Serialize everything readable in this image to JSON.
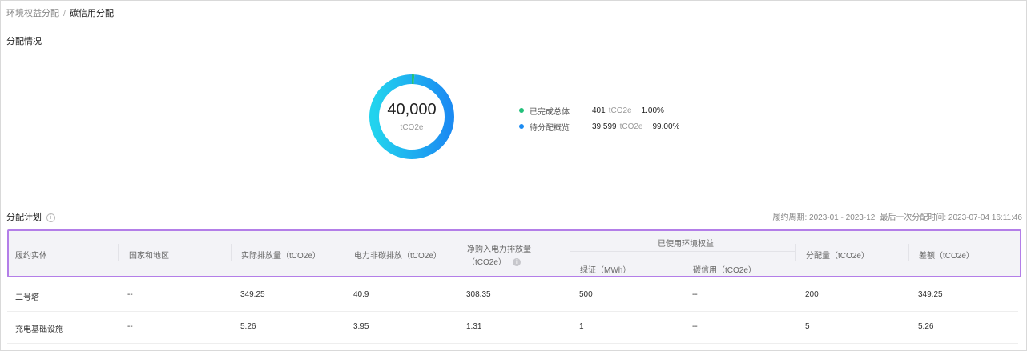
{
  "breadcrumb": {
    "parent": "环境权益分配",
    "separator": "/",
    "current": "碳信用分配"
  },
  "distribution": {
    "title": "分配情况",
    "total_value": "40,000",
    "total_unit": "tCO2e",
    "legend": [
      {
        "label": "已完成总体",
        "value": "401",
        "unit": "tCO2e",
        "percent": "1.00%",
        "color": "#22c07a",
        "fraction": 0.01
      },
      {
        "label": "待分配概览",
        "value": "39,599",
        "unit": "tCO2e",
        "percent": "99.00%",
        "color": "#1b8bf2",
        "fraction": 0.99
      }
    ]
  },
  "plan": {
    "title": "分配计划",
    "period_label": "履约周期: 2023-01 - 2023-12",
    "last_alloc_label": "最后一次分配时间: 2023-07-04 16:11:46"
  },
  "table": {
    "headers": {
      "entity": "履约实体",
      "region": "国家和地区",
      "actual": "实际排放量（tCO2e）",
      "power_noncarbon": "电力非碳排放（tCO2e）",
      "net_purchase_line1": "净购入电力排放量",
      "net_purchase_line2": "（tCO2e）",
      "used_group": "已使用环境权益",
      "green_cert": "绿证（MWh）",
      "carbon_credit": "碳信用（tCO2e）",
      "allocation": "分配量（tCO2e）",
      "difference": "差额（tCO2e）"
    },
    "rows": [
      [
        "二号塔",
        "--",
        "349.25",
        "40.9",
        "308.35",
        "500",
        "--",
        "200",
        "349.25"
      ],
      [
        "充电基础设施",
        "--",
        "5.26",
        "3.95",
        "1.31",
        "1",
        "--",
        "5",
        "5.26"
      ]
    ]
  },
  "colors": {
    "accent_border": "#b37ee8",
    "donut_start": "#22d3ee",
    "donut_end": "#1b8bf2"
  }
}
